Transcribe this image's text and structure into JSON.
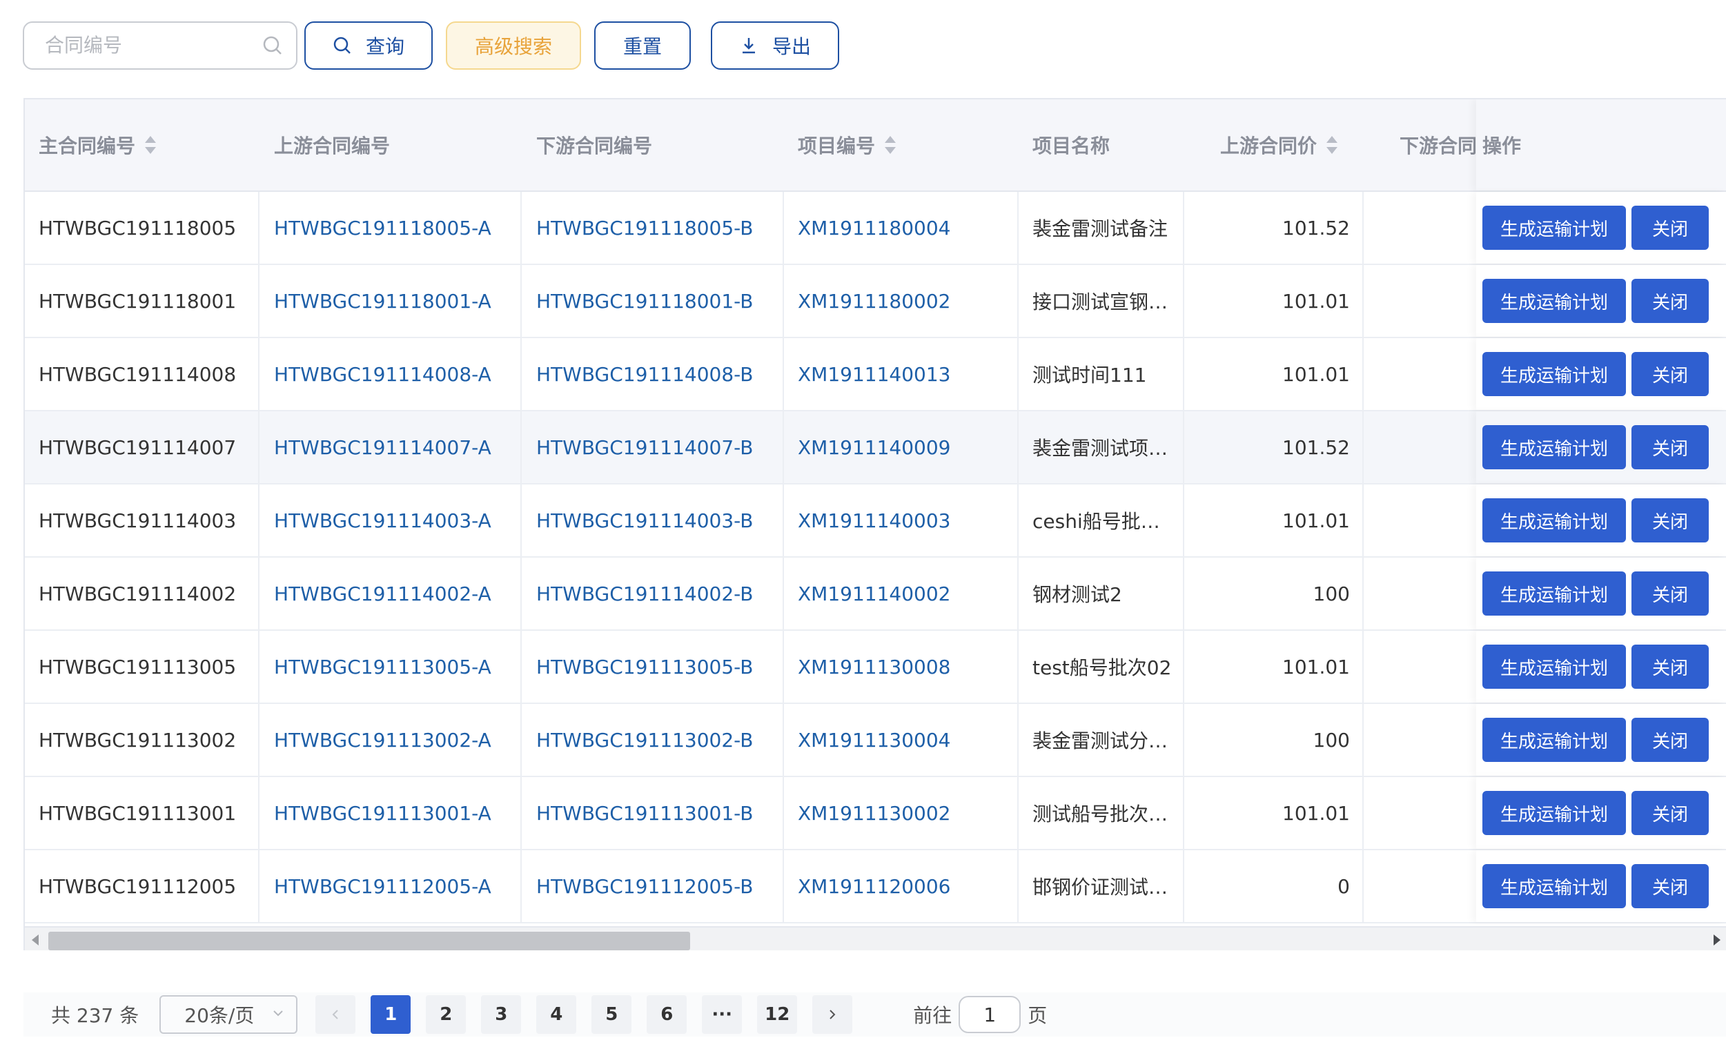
{
  "search": {
    "placeholder": "合同编号"
  },
  "toolbar": {
    "query_label": "查询",
    "advanced_label": "高级搜索",
    "reset_label": "重置",
    "export_label": "导出"
  },
  "table": {
    "headers": {
      "main_contract": "主合同编号",
      "upstream_contract": "上游合同编号",
      "downstream_contract": "下游合同编号",
      "project_no": "项目编号",
      "project_name": "项目名称",
      "upstream_price": "上游合同价",
      "downstream_price": "下游合同",
      "actions": "操作"
    },
    "rows": [
      {
        "main": "HTWBGC191118005",
        "up": "HTWBGC191118005-A",
        "down": "HTWBGC191118005-B",
        "proj": "XM1911180004",
        "name": "裴金雷测试备注",
        "price": "101.52"
      },
      {
        "main": "HTWBGC191118001",
        "up": "HTWBGC191118001-A",
        "down": "HTWBGC191118001-B",
        "proj": "XM1911180002",
        "name": "接口测试宣钢…",
        "price": "101.01"
      },
      {
        "main": "HTWBGC191114008",
        "up": "HTWBGC191114008-A",
        "down": "HTWBGC191114008-B",
        "proj": "XM1911140013",
        "name": "测试时间111",
        "price": "101.01"
      },
      {
        "main": "HTWBGC191114007",
        "up": "HTWBGC191114007-A",
        "down": "HTWBGC191114007-B",
        "proj": "XM1911140009",
        "name": "裴金雷测试项…",
        "price": "101.52"
      },
      {
        "main": "HTWBGC191114003",
        "up": "HTWBGC191114003-A",
        "down": "HTWBGC191114003-B",
        "proj": "XM1911140003",
        "name": "ceshi船号批…",
        "price": "101.01"
      },
      {
        "main": "HTWBGC191114002",
        "up": "HTWBGC191114002-A",
        "down": "HTWBGC191114002-B",
        "proj": "XM1911140002",
        "name": "钢材测试2",
        "price": "100"
      },
      {
        "main": "HTWBGC191113005",
        "up": "HTWBGC191113005-A",
        "down": "HTWBGC191113005-B",
        "proj": "XM1911130008",
        "name": "test船号批次02",
        "price": "101.01"
      },
      {
        "main": "HTWBGC191113002",
        "up": "HTWBGC191113002-A",
        "down": "HTWBGC191113002-B",
        "proj": "XM1911130004",
        "name": "裴金雷测试分…",
        "price": "100"
      },
      {
        "main": "HTWBGC191113001",
        "up": "HTWBGC191113001-A",
        "down": "HTWBGC191113001-B",
        "proj": "XM1911130002",
        "name": "测试船号批次…",
        "price": "101.01"
      },
      {
        "main": "HTWBGC191112005",
        "up": "HTWBGC191112005-A",
        "down": "HTWBGC191112005-B",
        "proj": "XM1911120006",
        "name": "邯钢价证测试…",
        "price": "0"
      }
    ],
    "action_labels": {
      "generate": "生成运输计划",
      "close": "关闭"
    }
  },
  "pagination": {
    "total": "共 237 条",
    "page_size": "20条/页",
    "pages": [
      "1",
      "2",
      "3",
      "4",
      "5",
      "6",
      "···",
      "12"
    ],
    "current_page": "1",
    "goto_label": "前往",
    "goto_value": "1",
    "page_suffix": "页"
  },
  "colors": {
    "primary": "#2f5fd0",
    "link": "#1e5fa8",
    "outline": "#1e50a2",
    "advanced_bg": "#fdf6e4",
    "advanced_text": "#e8a33a",
    "header_bg": "#f5f6fa"
  }
}
